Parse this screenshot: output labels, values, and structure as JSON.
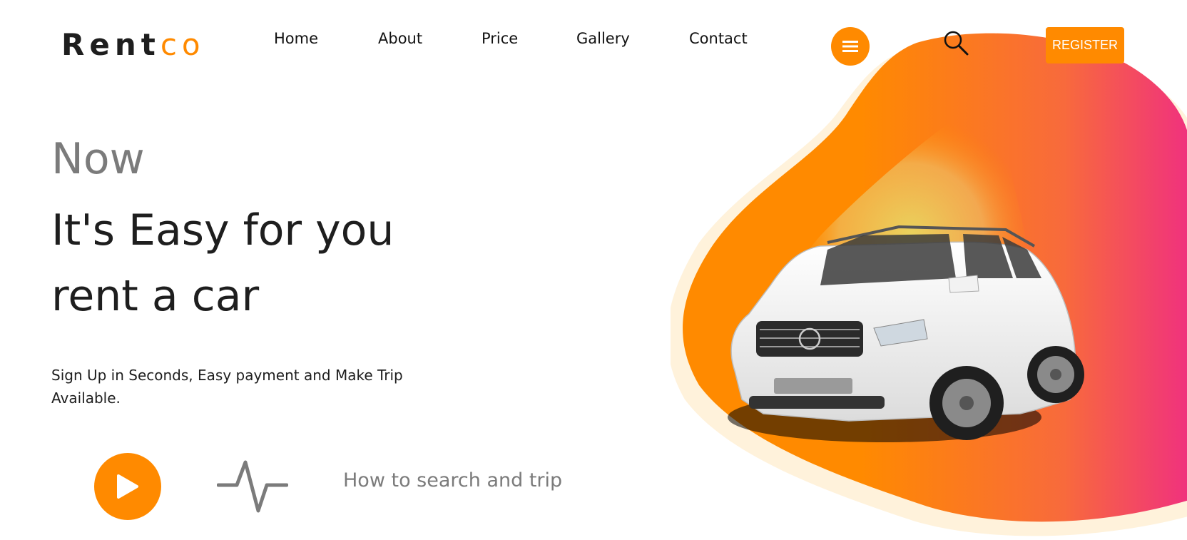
{
  "brand": {
    "name_main": "Rent",
    "name_accent": "co"
  },
  "nav": {
    "items": [
      {
        "label": "Home"
      },
      {
        "label": "About"
      },
      {
        "label": "Price"
      },
      {
        "label": "Gallery"
      },
      {
        "label": "Contact"
      }
    ]
  },
  "header": {
    "menu_icon": "hamburger-icon",
    "search_icon": "search-icon",
    "register_label": "REGISTER"
  },
  "hero": {
    "kicker": "Now",
    "headline_line1": "It's Easy for you",
    "headline_line2": "rent a car",
    "subtitle": "Sign Up in Seconds, Easy payment and Make Trip Available.",
    "play_icon": "play-icon",
    "pulse_icon": "heartbeat-icon",
    "video_link": "How to search and trip"
  },
  "colors": {
    "accent": "#ff8a00",
    "gradient_end": "#f0307f",
    "text_dark": "#1e1e1e",
    "text_muted": "#7b7b7b"
  }
}
